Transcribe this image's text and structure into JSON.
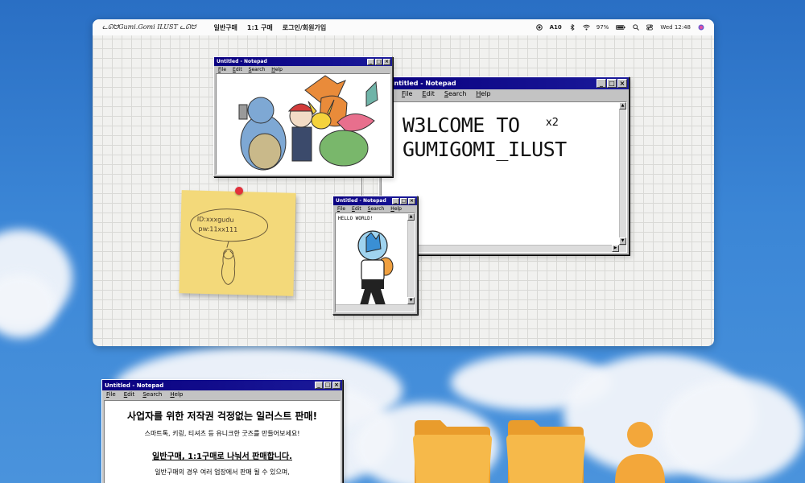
{
  "menubar": {
    "logo": "ᓚᘏᗢGumi.Gomi ILUST ᓚᘏᗢ",
    "items": [
      "일반구매",
      "1:1 구매",
      "로그인/회원가입"
    ],
    "status": {
      "battery": "97%",
      "badge": "10",
      "clock": "Wed 12:48"
    }
  },
  "windows": {
    "main": {
      "title": "Untitled - Notepad",
      "menus": [
        "File",
        "Edit",
        "Search",
        "Help"
      ],
      "text_line1": "W3LCOME TO",
      "text_line2": "GUMIGOMI_ILUST",
      "scribble": "x2"
    },
    "picture": {
      "title": "Untitled - Notepad",
      "menus": [
        "File",
        "Edit",
        "Search",
        "Help"
      ]
    },
    "hello": {
      "title": "Untitled - Notepad",
      "menus": [
        "File",
        "Edit",
        "Search",
        "Help"
      ],
      "text": "HELLO WORLD!"
    },
    "bottom": {
      "title": "Untitled - Notepad",
      "menus": [
        "File",
        "Edit",
        "Search",
        "Help"
      ],
      "heading": "사업자를 위한 저작권 걱정없는 일러스트 판매!",
      "line1": "스마트톡, 키링, 티셔츠 등 유니크한 굿즈를 만들어보세요!",
      "heading2": "일반구매, 1:1구매로 나눠서 판매합니다.",
      "line2": "일반구매의 경우 여러 업장에서 판매 될 수 있으며,"
    }
  },
  "sticky_note": {
    "line1": "ID:xxxgudu",
    "line2": "pw:11xx111"
  },
  "colors": {
    "titlebar": "#0a0080",
    "folder": "#f3b13a",
    "user_icon": "#f3a73a",
    "sticky": "#f3d97a"
  },
  "icons": [
    "folder-icon",
    "folder-icon",
    "user-icon"
  ]
}
